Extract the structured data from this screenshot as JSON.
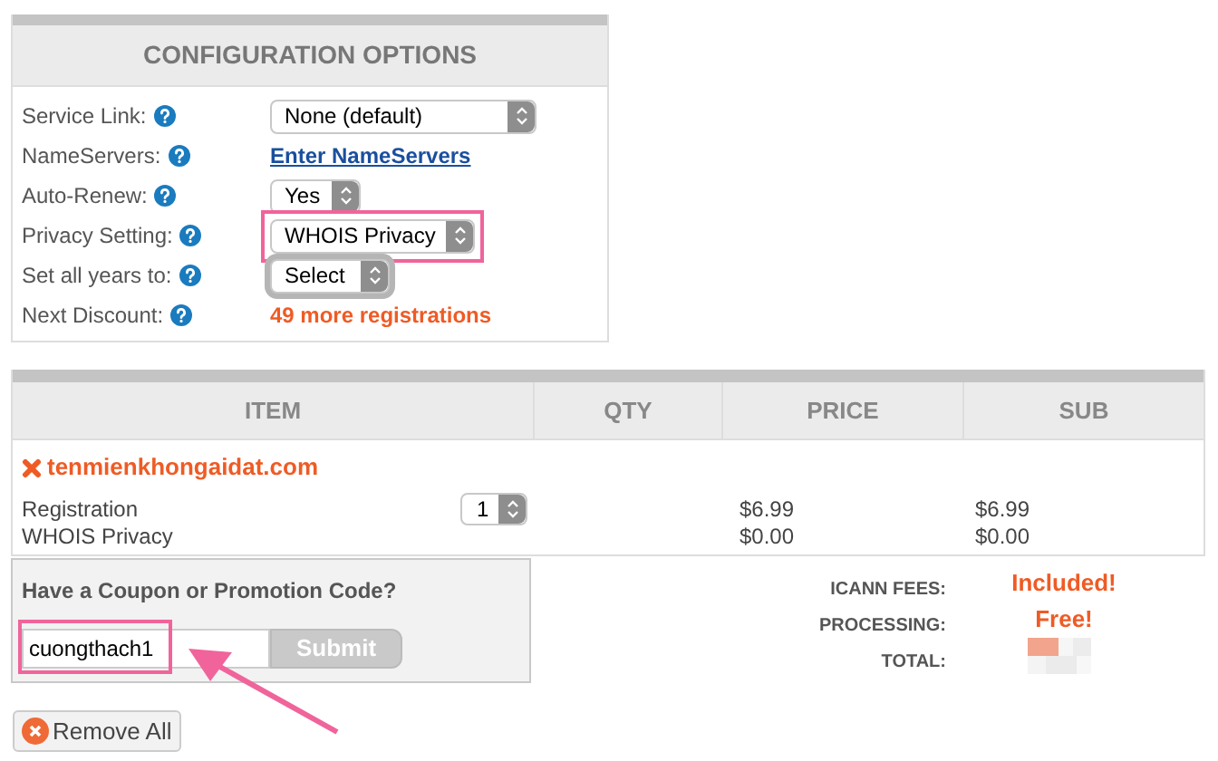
{
  "config": {
    "title": "CONFIGURATION OPTIONS",
    "options": [
      {
        "label": "Service Link:",
        "kind": "select",
        "value": "None (default)",
        "highlighted": false,
        "focused": false
      },
      {
        "label": "NameServers:",
        "kind": "link",
        "value": "Enter NameServers"
      },
      {
        "label": "Auto-Renew:",
        "kind": "select",
        "value": "Yes",
        "highlighted": false,
        "focused": false
      },
      {
        "label": "Privacy Setting:",
        "kind": "select",
        "value": "WHOIS Privacy",
        "highlighted": true,
        "focused": false
      },
      {
        "label": "Set all years to:",
        "kind": "select",
        "value": "Select",
        "highlighted": false,
        "focused": true
      },
      {
        "label": "Next Discount:",
        "kind": "note",
        "value": "49 more registrations"
      }
    ]
  },
  "cart": {
    "columns": [
      "ITEM",
      "QTY",
      "PRICE",
      "SUB"
    ],
    "domain": "tenmienkhongaidat.com",
    "lines": [
      {
        "name": "Registration",
        "qty": "1",
        "price": "$6.99",
        "sub": "$6.99"
      },
      {
        "name": "WHOIS Privacy",
        "price": "$0.00",
        "sub": "$0.00"
      }
    ]
  },
  "coupon": {
    "title": "Have a Coupon or Promotion Code?",
    "value": "cuongthach1",
    "button": "Submit",
    "highlighted": true
  },
  "totals": [
    {
      "label": "ICANN FEES:",
      "kind": "text",
      "value": "Included!"
    },
    {
      "label": "PROCESSING:",
      "kind": "text",
      "value": "Free!"
    },
    {
      "label": "TOTAL:",
      "kind": "redacted"
    }
  ],
  "remove_all": "Remove All"
}
